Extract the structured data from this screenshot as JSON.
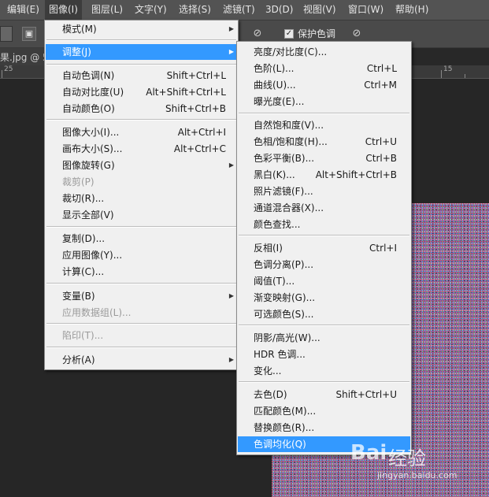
{
  "menubar": {
    "items": [
      "编辑(E)",
      "图像(I)",
      "图层(L)",
      "文字(Y)",
      "选择(S)",
      "滤镜(T)",
      "3D(D)",
      "视图(V)",
      "窗口(W)",
      "帮助(H)"
    ]
  },
  "optionsbar": {
    "protect_color_label": "保护色调",
    "protect_checked": "✓"
  },
  "document": {
    "tab_title": "果.jpg @ 50",
    "ruler_left": "25",
    "ruler_right": "15"
  },
  "image_menu": {
    "items": [
      {
        "label": "模式(M)",
        "shortcut": ""
      },
      {
        "label": "调整(J)",
        "shortcut": ""
      },
      {
        "label": "自动色调(N)",
        "shortcut": "Shift+Ctrl+L"
      },
      {
        "label": "自动对比度(U)",
        "shortcut": "Alt+Shift+Ctrl+L"
      },
      {
        "label": "自动颜色(O)",
        "shortcut": "Shift+Ctrl+B"
      },
      {
        "label": "图像大小(I)...",
        "shortcut": "Alt+Ctrl+I"
      },
      {
        "label": "画布大小(S)...",
        "shortcut": "Alt+Ctrl+C"
      },
      {
        "label": "图像旋转(G)",
        "shortcut": ""
      },
      {
        "label": "裁剪(P)",
        "shortcut": ""
      },
      {
        "label": "裁切(R)...",
        "shortcut": ""
      },
      {
        "label": "显示全部(V)",
        "shortcut": ""
      },
      {
        "label": "复制(D)...",
        "shortcut": ""
      },
      {
        "label": "应用图像(Y)...",
        "shortcut": ""
      },
      {
        "label": "计算(C)...",
        "shortcut": ""
      },
      {
        "label": "变量(B)",
        "shortcut": ""
      },
      {
        "label": "应用数据组(L)...",
        "shortcut": ""
      },
      {
        "label": "陷印(T)...",
        "shortcut": ""
      },
      {
        "label": "分析(A)",
        "shortcut": ""
      }
    ]
  },
  "adjust_menu": {
    "items": [
      {
        "label": "亮度/对比度(C)...",
        "shortcut": ""
      },
      {
        "label": "色阶(L)...",
        "shortcut": "Ctrl+L"
      },
      {
        "label": "曲线(U)...",
        "shortcut": "Ctrl+M"
      },
      {
        "label": "曝光度(E)...",
        "shortcut": ""
      },
      {
        "label": "自然饱和度(V)...",
        "shortcut": ""
      },
      {
        "label": "色相/饱和度(H)...",
        "shortcut": "Ctrl+U"
      },
      {
        "label": "色彩平衡(B)...",
        "shortcut": "Ctrl+B"
      },
      {
        "label": "黑白(K)...",
        "shortcut": "Alt+Shift+Ctrl+B"
      },
      {
        "label": "照片滤镜(F)...",
        "shortcut": ""
      },
      {
        "label": "通道混合器(X)...",
        "shortcut": ""
      },
      {
        "label": "颜色查找...",
        "shortcut": ""
      },
      {
        "label": "反相(I)",
        "shortcut": "Ctrl+I"
      },
      {
        "label": "色调分离(P)...",
        "shortcut": ""
      },
      {
        "label": "阈值(T)...",
        "shortcut": ""
      },
      {
        "label": "渐变映射(G)...",
        "shortcut": ""
      },
      {
        "label": "可选颜色(S)...",
        "shortcut": ""
      },
      {
        "label": "阴影/高光(W)...",
        "shortcut": ""
      },
      {
        "label": "HDR 色调...",
        "shortcut": ""
      },
      {
        "label": "变化...",
        "shortcut": ""
      },
      {
        "label": "去色(D)",
        "shortcut": "Shift+Ctrl+U"
      },
      {
        "label": "匹配颜色(M)...",
        "shortcut": ""
      },
      {
        "label": "替换颜色(R)...",
        "shortcut": ""
      },
      {
        "label": "色调均化(Q)",
        "shortcut": ""
      }
    ]
  },
  "watermark": {
    "brand": "经验",
    "url": "jingyan.baidu.com",
    "logo": "Bai"
  },
  "colors": {
    "highlight": "#3399ff",
    "menu_bg": "#f0f0f0",
    "menubar_bg": "#535353"
  }
}
